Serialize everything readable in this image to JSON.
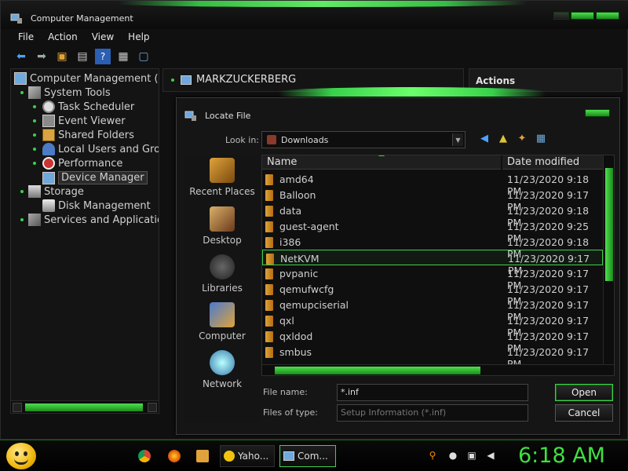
{
  "window": {
    "title": "Computer Management",
    "menu": [
      "File",
      "Action",
      "View",
      "Help"
    ]
  },
  "tree": {
    "root": "Computer Management (Loc",
    "system_tools": "System Tools",
    "task_scheduler": "Task Scheduler",
    "event_viewer": "Event Viewer",
    "shared_folders": "Shared Folders",
    "local_users": "Local Users and Grou",
    "performance": "Performance",
    "device_manager": "Device Manager",
    "storage": "Storage",
    "disk_management": "Disk Management",
    "services": "Services and Applications"
  },
  "middle": {
    "computer_name": "MARKZUCKERBERG"
  },
  "actions": {
    "title": "Actions"
  },
  "dialog": {
    "title": "Locate File",
    "look_in_label": "Look in:",
    "look_in_value": "Downloads",
    "places": [
      "Recent Places",
      "Desktop",
      "Libraries",
      "Computer",
      "Network"
    ],
    "columns": {
      "name": "Name",
      "date": "Date modified"
    },
    "files": [
      {
        "name": "amd64",
        "date": "11/23/2020 9:18 PM"
      },
      {
        "name": "Balloon",
        "date": "11/23/2020 9:17 PM"
      },
      {
        "name": "data",
        "date": "11/23/2020 9:18 PM"
      },
      {
        "name": "guest-agent",
        "date": "11/23/2020 9:25 PM"
      },
      {
        "name": "i386",
        "date": "11/23/2020 9:18 PM"
      },
      {
        "name": "NetKVM",
        "date": "11/23/2020 9:17 PM"
      },
      {
        "name": "pvpanic",
        "date": "11/23/2020 9:17 PM"
      },
      {
        "name": "qemufwcfg",
        "date": "11/23/2020 9:17 PM"
      },
      {
        "name": "qemupciserial",
        "date": "11/23/2020 9:17 PM"
      },
      {
        "name": "qxl",
        "date": "11/23/2020 9:17 PM"
      },
      {
        "name": "qxldod",
        "date": "11/23/2020 9:17 PM"
      },
      {
        "name": "smbus",
        "date": "11/23/2020 9:17 PM"
      }
    ],
    "file_name_label": "File name:",
    "file_name_value": "*.inf",
    "file_type_label": "Files of type:",
    "file_type_value": "Setup Information (*.inf)",
    "open_label": "Open",
    "cancel_label": "Cancel"
  },
  "taskbar": {
    "yahoo_label": "Yaho...",
    "cm_label": "Com...",
    "clock": "6:18 AM"
  },
  "colors": {
    "accent": "#3fd04f",
    "background": "#101010",
    "folder": "#e0a23a",
    "clock": "#3fe03f"
  }
}
